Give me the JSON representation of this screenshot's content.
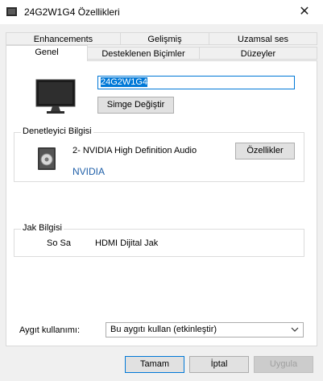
{
  "window": {
    "title": "24G2W1G4 Özellikleri",
    "close_glyph": "✕"
  },
  "tabs": {
    "row1": [
      {
        "label": "Enhancements"
      },
      {
        "label": "Gelişmiş"
      },
      {
        "label": "Uzamsal ses"
      }
    ],
    "row2": [
      {
        "label": "Genel",
        "active": true
      },
      {
        "label": "Desteklenen Biçimler"
      },
      {
        "label": "Düzeyler"
      }
    ]
  },
  "device": {
    "icon": "monitor-icon",
    "name_value": "24G2W1G4",
    "change_icon_label": "Simge Değiştir"
  },
  "controller": {
    "group_title": "Denetleyici Bilgisi",
    "icon": "speaker-icon",
    "name": "2- NVIDIA High Definition Audio",
    "vendor": "NVIDIA",
    "properties_label": "Özellikler"
  },
  "jack": {
    "group_title": "Jak Bilgisi",
    "side": "So Sa",
    "type": "HDMI Dijital Jak"
  },
  "usage": {
    "label": "Aygıt kullanımı:",
    "selected": "Bu aygıtı kullan (etkinleştir)"
  },
  "footer": {
    "ok": "Tamam",
    "cancel": "İptal",
    "apply": "Uygula"
  },
  "colors": {
    "accent": "#0078d7",
    "link": "#1f5fa8"
  }
}
